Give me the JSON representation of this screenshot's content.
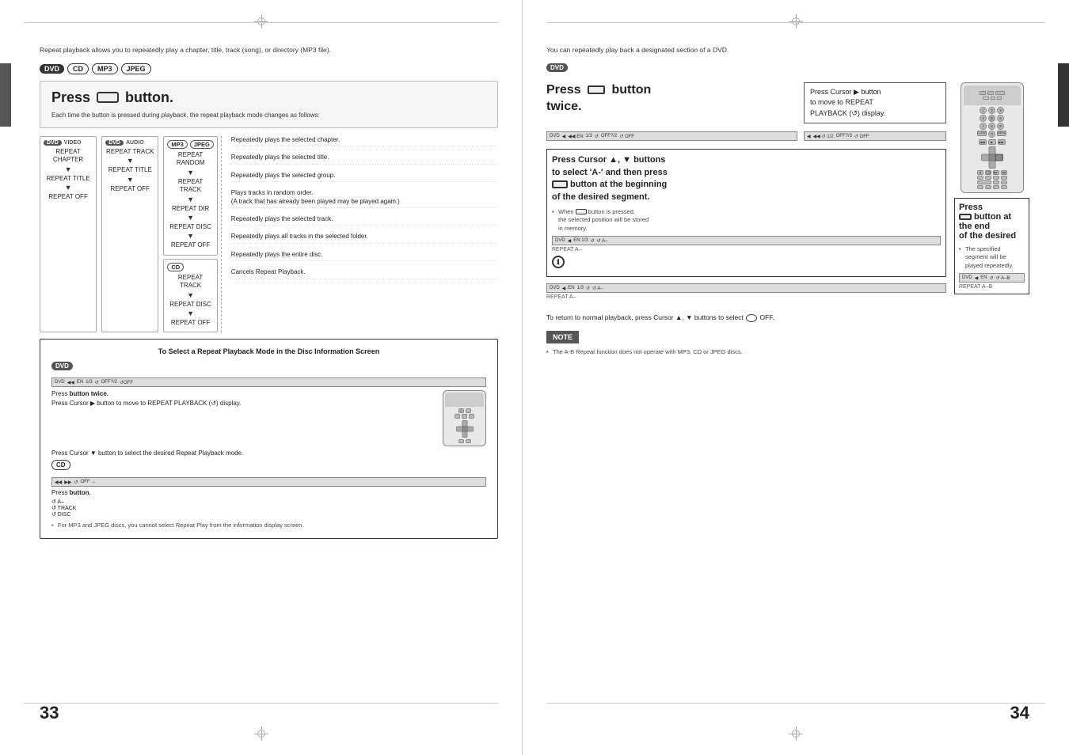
{
  "left_page": {
    "page_number": "33",
    "intro_text": "Repeat playback allows you to repeatedly play a chapter, title, track (song), or directory (MP3 file).",
    "formats": [
      "DVD",
      "CD",
      "MP3",
      "JPEG"
    ],
    "press_section": {
      "label": "Press",
      "button_label": "button.",
      "description": "Each time the button is pressed during playback, the repeat playback mode changes as follows:"
    },
    "dvd_video_modes": [
      "REPEAT CHAPTER",
      "▼",
      "REPEAT TITLE",
      "▼",
      "REPEAT OFF"
    ],
    "dvd_audio_modes": [
      "REPEAT TRACK",
      "▼",
      "REPEAT TITLE",
      "▼",
      "REPEAT OFF"
    ],
    "mp3_modes": [
      "REPEAT RANDOM",
      "▼",
      "REPEAT TRACK",
      "▼",
      "REPEAT DIR",
      "▼",
      "REPEAT DISC",
      "▼",
      "REPEAT OFF"
    ],
    "jpeg_modes": [
      "REPEAT TRACK",
      "▼",
      "REPEAT DISC",
      "▼",
      "REPEAT OFF"
    ],
    "cd_modes": [
      "REPEAT TRACK",
      "▼",
      "REPEAT DISC",
      "▼",
      "REPEAT OFF"
    ],
    "descriptions": [
      "Repeatedly plays the selected chapter.",
      "Repeatedly plays the selected title.",
      "Repeatedly plays the selected group.",
      "Plays tracks in random order. (A track that has already been played may be played again.)",
      "Repeatedly plays the selected track.",
      "Repeatedly plays all tracks in the selected folder.",
      "Repeatedly plays the entire disc.",
      "Cancels Repeat Playback."
    ],
    "info_box": {
      "title": "To Select a Repeat Playback Mode in the Disc Information Screen",
      "dvd_badge": "DVD",
      "steps": [
        "Press button twice.",
        "Press Cursor ▶ button to move to REPEAT PLAYBACK (↺) display.",
        "Press Cursor ▼ button to select the desired Repeat Playback mode.",
        "Press button."
      ],
      "cd_badge": "CD",
      "note": "For MP3 and JPEG discs, you cannot select Repeat Play from the information display screen."
    }
  },
  "right_page": {
    "page_number": "34",
    "intro_text": "You can repeatedly play back a designated section of a DVD.",
    "dvd_badge": "DVD",
    "section1": {
      "press_twice": {
        "label": "Press",
        "button_label": "button",
        "action": "twice."
      },
      "cursor_note": "Press Cursor ▶ button to move to REPEAT PLAYBACK (↺) display."
    },
    "section2": {
      "title": "Press Cursor ▲, ▼ buttons to select 'A-' and then press button at the beginning of the desired segment.",
      "note": "When button is pressed, the selected position will be stored in memory."
    },
    "section3": {
      "title": "Press button at the end of the desired",
      "note": "The specified segment will be played repeatedly."
    },
    "return_section": {
      "text": "To return to normal playback, press Cursor ▲, ▼ buttons to select ↺ OFF."
    },
    "warning": {
      "badge": "NOTE",
      "text": "The A-B Repeat function does not operate with MP3, CD or JPEG discs."
    },
    "repeat_labels": {
      "repeat_a": "REPEAT A–",
      "repeat_ab": "REPEAT A–B"
    }
  }
}
